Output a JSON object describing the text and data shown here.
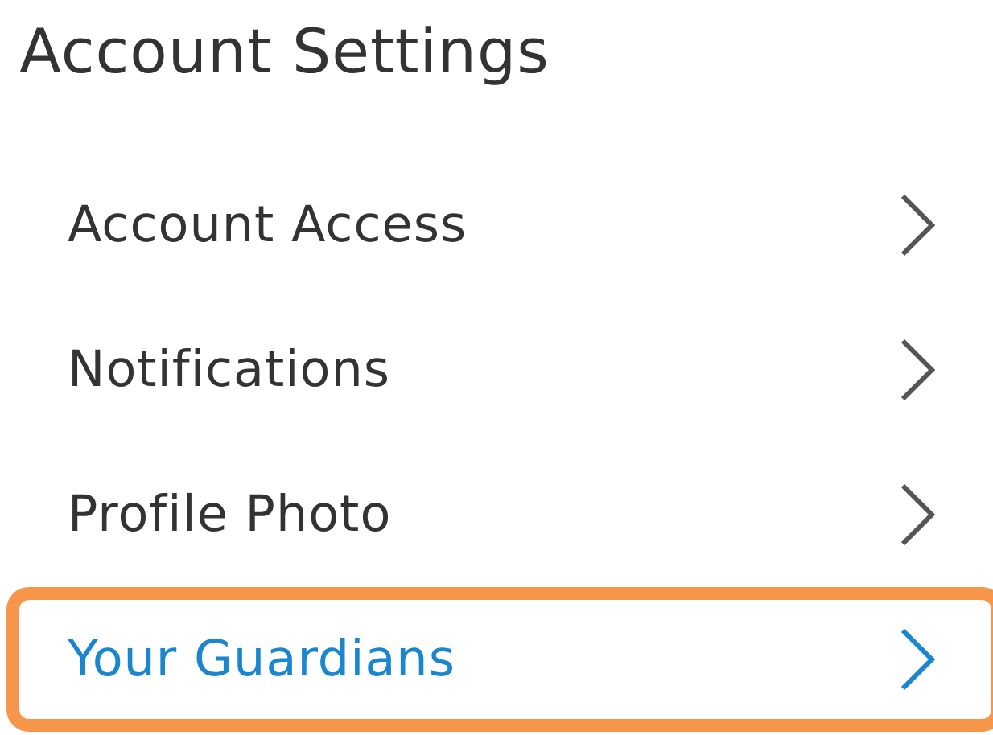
{
  "title": "Account Settings",
  "items": [
    {
      "label": "Account Access",
      "selected": false
    },
    {
      "label": "Notifications",
      "selected": false
    },
    {
      "label": "Profile Photo",
      "selected": false
    },
    {
      "label": "Your Guardians",
      "selected": true
    }
  ]
}
